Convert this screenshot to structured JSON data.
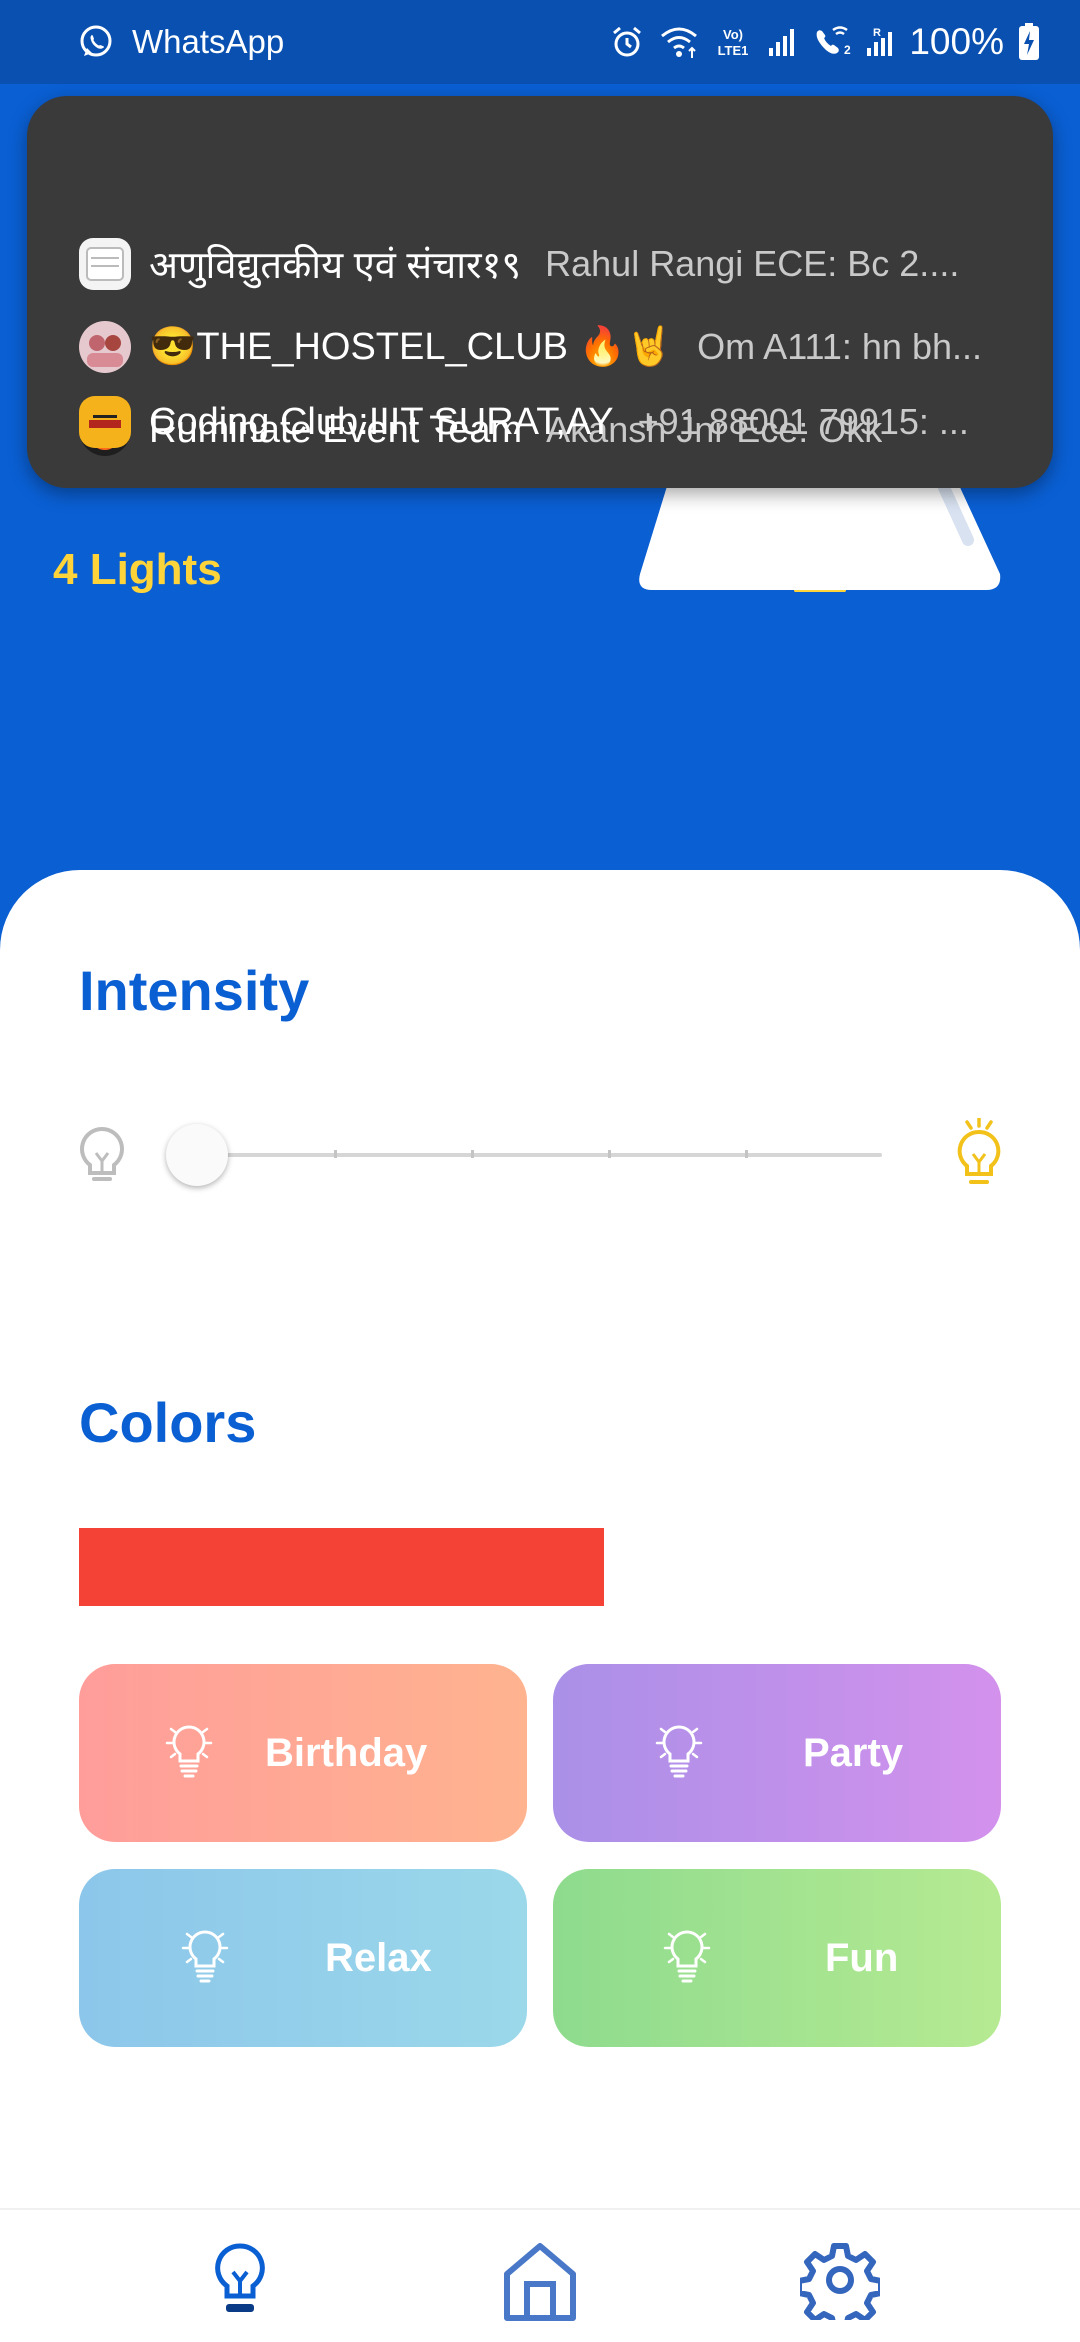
{
  "status_bar": {
    "app_name": "WhatsApp",
    "battery": "100%",
    "icons": [
      "whatsapp-icon",
      "alarm-icon",
      "wifi-icon",
      "volte-icon",
      "signal-icon",
      "wifi-calling-icon",
      "signal-icon",
      "battery-charging-icon"
    ]
  },
  "notification": {
    "rows": [
      {
        "title": "अणुविद्युतकीय एवं संचार१९",
        "message": "Rahul Rangi ECE: Bc 2....",
        "avatar": "group-avatar"
      },
      {
        "title": "😎THE_HOSTEL_CLUB 🔥🤘",
        "message": "Om A111: hn bh...",
        "avatar": "group-avatar"
      },
      {
        "title": "Ruminate Event Team",
        "message": "Akansh Jnr Ece: Okk",
        "avatar": "fire-avatar"
      },
      {
        "title": "Coding Club:IIIT SURAT,AY",
        "message": "+91 88001 79915: ...",
        "avatar": "coding-mafia-avatar"
      }
    ]
  },
  "hero": {
    "lights_count": "4 Lights"
  },
  "intensity": {
    "title": "Intensity",
    "value": 0
  },
  "colors": {
    "title": "Colors",
    "selected_color": "#f44336",
    "presets": [
      {
        "label": "Birthday",
        "from": "#ff9d9a",
        "to": "#ffb38f"
      },
      {
        "label": "Party",
        "from": "#aa90e8",
        "to": "#d391ec"
      },
      {
        "label": "Relax",
        "from": "#8cc6ea",
        "to": "#9bd8ea"
      },
      {
        "label": "Fun",
        "from": "#8edb8e",
        "to": "#b6ea92"
      }
    ]
  },
  "bottom_nav": {
    "items": [
      "bulb-icon",
      "home-icon",
      "gear-icon"
    ],
    "active": "bulb-icon"
  },
  "theme": {
    "primary": "#0a5fd3",
    "accent": "#ffd43b"
  }
}
